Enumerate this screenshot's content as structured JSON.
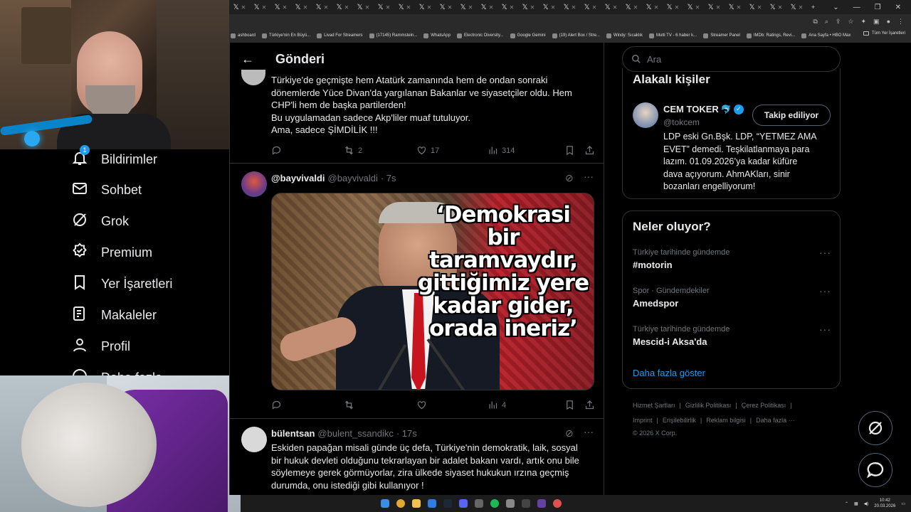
{
  "browser": {
    "tab_count": 28,
    "bookmarks": [
      "ashboard",
      "Türkiye'nin En Büyü...",
      "Livad For Streamers",
      "(17145) Rammstein...",
      "WhatsApp",
      "Electronic Diversity...",
      "Google Gemini",
      "(19) Alert Box / Stre...",
      "Windy: Sıcaklık",
      "Multi TV - 6 haber k...",
      "Streamer Panel",
      "IMDb: Ratings, Revi...",
      "Ana Sayfa • HBO Max"
    ],
    "all_bookmarks": "Tüm Yer İşaretleri"
  },
  "nav": {
    "items": [
      {
        "label": "Bildirimler",
        "icon": "bell-icon",
        "badge": "1"
      },
      {
        "label": "Sohbet",
        "icon": "mail-icon"
      },
      {
        "label": "Grok",
        "icon": "grok-icon"
      },
      {
        "label": "Premium",
        "icon": "premium-icon"
      },
      {
        "label": "Yer İşaretleri",
        "icon": "bookmark-icon"
      },
      {
        "label": "Makaleler",
        "icon": "article-icon"
      },
      {
        "label": "Profil",
        "icon": "profile-icon"
      },
      {
        "label": "Daha fazla",
        "icon": "more-icon"
      }
    ]
  },
  "main": {
    "header_title": "Gönderi",
    "tweet1": {
      "text_lines": [
        "Türkiye'de geçmişte hem Atatürk zamanında hem de ondan sonraki",
        "dönemlerde Yüce Divan'da yargılanan Bakanlar ve siyasetçiler oldu. Hem",
        "CHP'li hem de başka partilerden!",
        "Bu uygulamadan sadece Akp'liler muaf tutuluyor.",
        "Ama, sadece ŞİMDİLİK !!!"
      ],
      "retweets": "2",
      "likes": "17",
      "views": "314"
    },
    "tweet2": {
      "name": "@bayvivaldi",
      "handle": "@bayvivaldi",
      "time": "· 7s",
      "image_quote_lines": [
        "‘Demokrasi",
        "bir taramvaydır,",
        "gittiğimiz yere",
        "kadar gider,",
        "orada ineriz’"
      ],
      "views": "4"
    },
    "tweet3": {
      "name": "bülentsan",
      "handle": "@bulent_ssandikc",
      "time": "· 17s",
      "text_lines": [
        "Eskiden papağan misali günde üç defa, Türkiye'nin demokratik, laik, sosyal",
        "bir hukuk devleti olduğunu tekrarlayan bir adalet bakanı vardı, artık onu bile",
        "söylemeye gerek görmüyorlar, zira ülkede siyaset hukukun ırzına geçmiş",
        "durumda, onu istediği gibi kullanıyor !"
      ]
    }
  },
  "right": {
    "search_placeholder": "Ara",
    "related_title": "Alakalı kişiler",
    "person": {
      "name": "CEM TOKER",
      "emoji": "🐬",
      "handle": "@tokcem",
      "follow_label": "Takip ediliyor",
      "bio_lines": [
        "LDP eski Gn.Bşk. LDP, “YETMEZ AMA",
        "EVET” demedi. Teşkilatlanmaya para",
        "lazım. 01.09.2026’ya kadar küfüre",
        "dava açıyorum. AhmAKları, sinir",
        "bozanları engelliyorum!"
      ]
    },
    "trends_title": "Neler oluyor?",
    "trends": [
      {
        "meta": "Türkiye tarihinde gündemde",
        "name": "#motorin"
      },
      {
        "meta": "Spor · Gündemdekiler",
        "name": "Amedspor"
      },
      {
        "meta": "Türkiye tarihinde gündemde",
        "name": "Mescid-i Aksa'da"
      }
    ],
    "show_more": "Daha fazla göster",
    "footer_row1": [
      "Hizmet Şartları",
      "Gizlilik Politikası",
      "Çerez Politikası"
    ],
    "footer_row2": [
      "Imprint",
      "Erişilebilirlik",
      "Reklam bilgisi",
      "Daha fazla ···"
    ],
    "copyright": "© 2026 X Corp."
  },
  "taskbar": {
    "time": "10:42",
    "date": "20.03.2026"
  },
  "colors": {
    "accent": "#1d9bf0",
    "text": "#e7e9ea",
    "muted": "#71767b",
    "border": "#2f3336"
  }
}
